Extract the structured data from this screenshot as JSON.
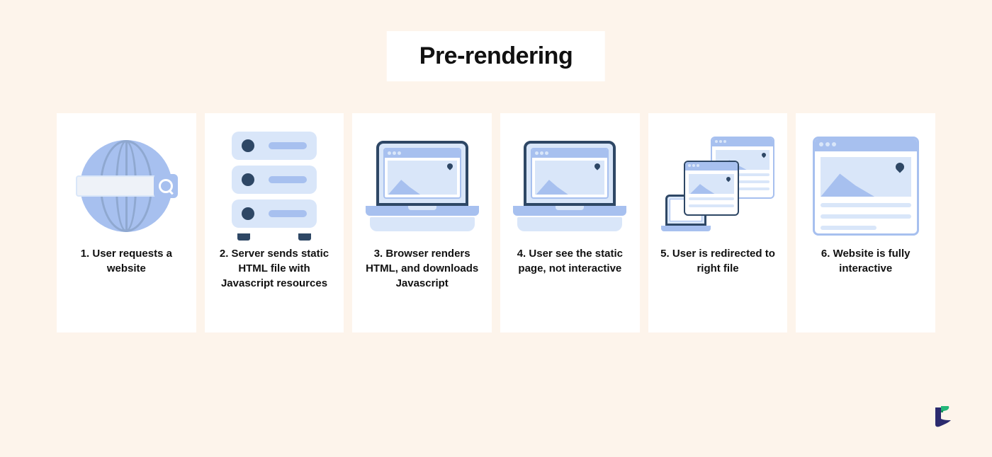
{
  "title": "Pre-rendering",
  "steps": [
    {
      "label": "1. User requests a website"
    },
    {
      "label": "2.  Server sends static HTML file with Javascript resources"
    },
    {
      "label": "3. Browser renders HTML, and downloads Javascript"
    },
    {
      "label": "4. User see the static page, not interactive"
    },
    {
      "label": "5. User is redirected to right file"
    },
    {
      "label": "6. Website is fully interactive"
    }
  ]
}
